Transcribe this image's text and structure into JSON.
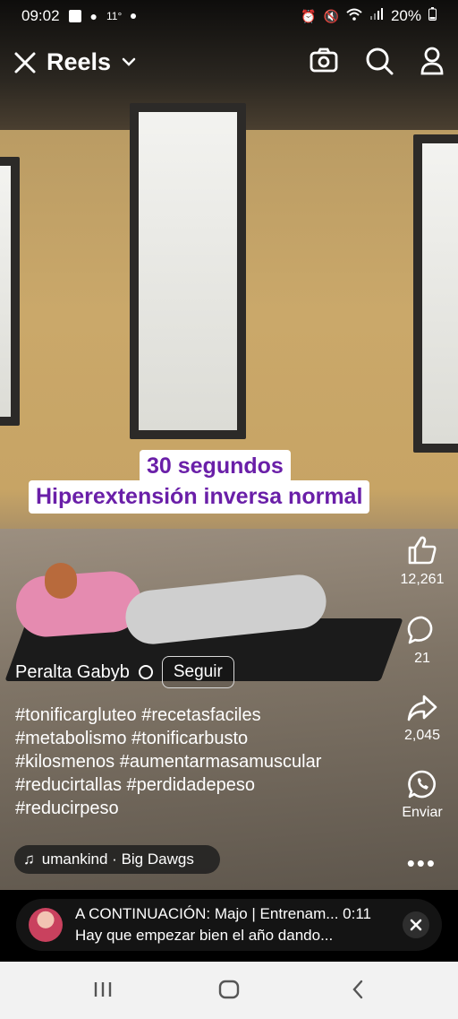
{
  "status_bar": {
    "time": "09:02",
    "temperature": "11°",
    "battery": "20%"
  },
  "header": {
    "title": "Reels"
  },
  "video": {
    "caption_line1": "30 segundos",
    "caption_line2": "Hiperextensión inversa normal"
  },
  "actions": {
    "likes": "12,261",
    "comments": "21",
    "shares": "2,045",
    "send_label": "Enviar"
  },
  "author": {
    "name": "Peralta Gabyb",
    "follow_label": "Seguir"
  },
  "hashtags": [
    "#tonificargluteo #recetasfaciles",
    "#metabolismo #tonificarbusto",
    "#kilosmenos #aumentarmasamuscular",
    "#reducirtallas #perdidadepeso",
    "#reducirpeso"
  ],
  "music": {
    "label": "umankind · Big Dawgs"
  },
  "next_up": {
    "line1": "A CONTINUACIÓN: Majo | Entrenam... 0:11",
    "line2": "Hay que empezar bien el año dando..."
  },
  "colors": {
    "caption_text": "#6a1fa8",
    "caption_bg": "#ffffff",
    "navbar_bg": "#f2f2f2"
  }
}
